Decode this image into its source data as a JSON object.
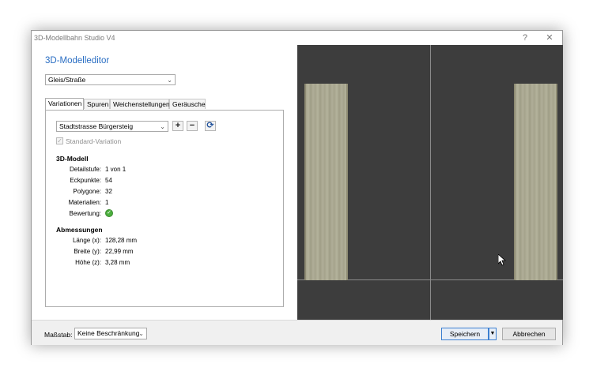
{
  "window": {
    "title": "3D-Modellbahn Studio V4",
    "help": "?",
    "close": "✕"
  },
  "editor": {
    "heading": "3D-Modelleditor",
    "category": "Gleis/Straße",
    "tabs": [
      "Variationen",
      "Spuren",
      "Weichenstellungen",
      "Geräusche"
    ],
    "variation": "Stadtstrasse Bürgersteig",
    "add": "+",
    "remove": "−",
    "refresh": "⟳",
    "standard_variation": "Standard-Variation",
    "model_section": "3D-Modell",
    "props": {
      "detail_label": "Detailstufe:",
      "detail_value": "1 von 1",
      "vertices_label": "Eckpunkte:",
      "vertices_value": "54",
      "polygons_label": "Polygone:",
      "polygons_value": "32",
      "materials_label": "Materialien:",
      "materials_value": "1",
      "rating_label": "Bewertung:"
    },
    "dims_section": "Abmessungen",
    "dims": {
      "length_label": "Länge (x):",
      "length_value": "128,28 mm",
      "width_label": "Breite (y):",
      "width_value": "22,99 mm",
      "height_label": "Höhe (z):",
      "height_value": "3,28 mm"
    }
  },
  "footer": {
    "scale_label": "Maßstab:",
    "scale_value": "Keine Beschränkung",
    "save": "Speichern",
    "cancel": "Abbrechen"
  }
}
